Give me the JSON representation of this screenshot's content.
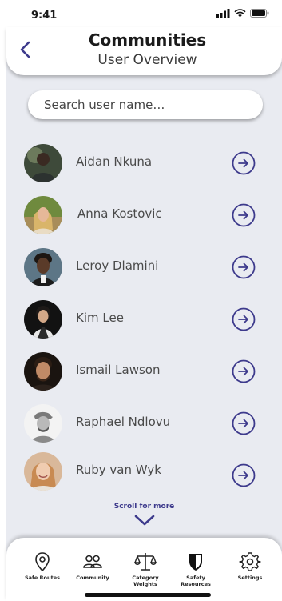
{
  "status_bar": {
    "time": "9:41"
  },
  "header": {
    "title": "Communities",
    "subtitle": "User Overview"
  },
  "search": {
    "placeholder": "Search user name…"
  },
  "users": [
    {
      "name": "Aidan Nkuna"
    },
    {
      "name": "Anna Kostovic"
    },
    {
      "name": "Leroy Dlamini"
    },
    {
      "name": "Kim Lee"
    },
    {
      "name": "Ismail Lawson"
    },
    {
      "name": "Raphael Ndlovu"
    },
    {
      "name": "Ruby van Wyk"
    }
  ],
  "scroll_hint": "Scroll for more",
  "nav": [
    {
      "label": "Safe Routes",
      "icon": "location-pin-icon"
    },
    {
      "label": "Community",
      "icon": "people-icon"
    },
    {
      "label": "Category Weights",
      "icon": "scale-icon"
    },
    {
      "label": "Safety Resources",
      "icon": "shield-icon"
    },
    {
      "label": "Settings",
      "icon": "gear-icon"
    }
  ],
  "colors": {
    "accent": "#3d3a8c",
    "panel": "#e9ebf1",
    "text": "#4a4a4a"
  }
}
